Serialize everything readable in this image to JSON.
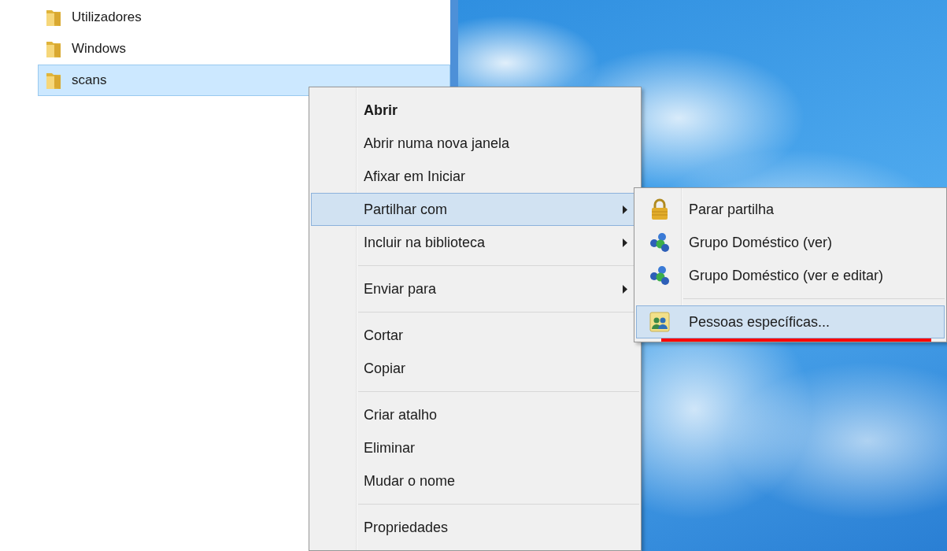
{
  "explorer": {
    "folders": [
      {
        "label": "Utilizadores",
        "selected": false
      },
      {
        "label": "Windows",
        "selected": false
      },
      {
        "label": "scans",
        "selected": true
      }
    ]
  },
  "context_menu": {
    "items": [
      {
        "kind": "item",
        "label": "Abrir",
        "default": true,
        "selected": false,
        "submenu": false
      },
      {
        "kind": "item",
        "label": "Abrir numa nova janela",
        "default": false,
        "selected": false,
        "submenu": false
      },
      {
        "kind": "item",
        "label": "Afixar em Iniciar",
        "default": false,
        "selected": false,
        "submenu": false
      },
      {
        "kind": "item",
        "label": "Partilhar com",
        "default": false,
        "selected": true,
        "submenu": true
      },
      {
        "kind": "item",
        "label": "Incluir na biblioteca",
        "default": false,
        "selected": false,
        "submenu": true
      },
      {
        "kind": "separator"
      },
      {
        "kind": "item",
        "label": "Enviar para",
        "default": false,
        "selected": false,
        "submenu": true
      },
      {
        "kind": "separator"
      },
      {
        "kind": "item",
        "label": "Cortar",
        "default": false,
        "selected": false,
        "submenu": false
      },
      {
        "kind": "item",
        "label": "Copiar",
        "default": false,
        "selected": false,
        "submenu": false
      },
      {
        "kind": "separator"
      },
      {
        "kind": "item",
        "label": "Criar atalho",
        "default": false,
        "selected": false,
        "submenu": false
      },
      {
        "kind": "item",
        "label": "Eliminar",
        "default": false,
        "selected": false,
        "submenu": false
      },
      {
        "kind": "item",
        "label": "Mudar o nome",
        "default": false,
        "selected": false,
        "submenu": false
      },
      {
        "kind": "separator"
      },
      {
        "kind": "item",
        "label": "Propriedades",
        "default": false,
        "selected": false,
        "submenu": false
      }
    ]
  },
  "share_submenu": {
    "items": [
      {
        "kind": "lock",
        "label": "Parar partilha",
        "selected": false
      },
      {
        "kind": "homegroup",
        "label": "Grupo Doméstico (ver)",
        "selected": false
      },
      {
        "kind": "homegroup",
        "label": "Grupo Doméstico (ver e editar)",
        "selected": false
      },
      {
        "kind": "separator"
      },
      {
        "kind": "people",
        "label": "Pessoas específicas...",
        "selected": true
      }
    ]
  }
}
